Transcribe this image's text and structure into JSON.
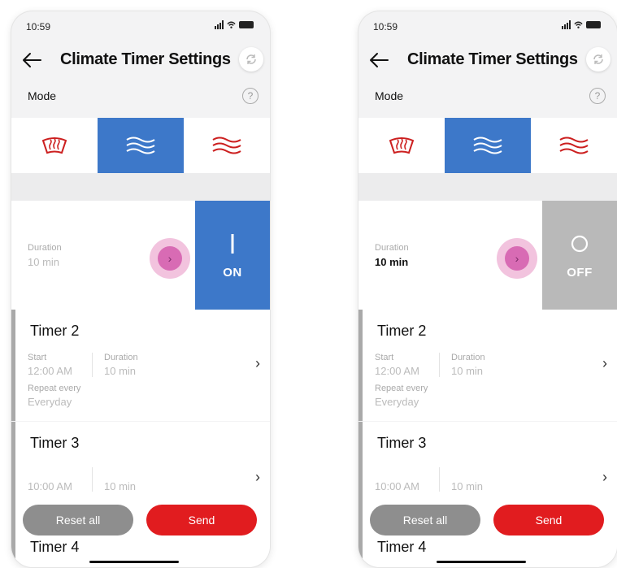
{
  "screens": [
    {
      "status_time": "10:59",
      "title": "Climate Timer Settings",
      "mode_label": "Mode",
      "help_glyph": "?",
      "modes": [
        {
          "icon": "defrost-icon",
          "active": false,
          "color": "#cc1f1f"
        },
        {
          "icon": "vent-airflow-icon",
          "active": true,
          "color": "#ffffff"
        },
        {
          "icon": "heat-airflow-icon",
          "active": false,
          "color": "#cc1f1f"
        }
      ],
      "timer1": {
        "duration_label": "Duration",
        "duration_value": "10 min",
        "toggle_label": "ON",
        "toggle_state": "on"
      },
      "timer2": {
        "name": "Timer 2",
        "start_label": "Start",
        "start_value": "12:00 AM",
        "duration_label": "Duration",
        "duration_value": "10 min",
        "repeat_label": "Repeat every",
        "repeat_value": "Everyday"
      },
      "timer3": {
        "name": "Timer 3",
        "start_value": "10:00 AM",
        "duration_value": "10 min"
      },
      "timer4": {
        "name": "Timer 4"
      },
      "reset_label": "Reset all",
      "send_label": "Send"
    },
    {
      "status_time": "10:59",
      "title": "Climate Timer Settings",
      "mode_label": "Mode",
      "help_glyph": "?",
      "modes": [
        {
          "icon": "defrost-icon",
          "active": false,
          "color": "#cc1f1f"
        },
        {
          "icon": "vent-airflow-icon",
          "active": true,
          "color": "#ffffff"
        },
        {
          "icon": "heat-airflow-icon",
          "active": false,
          "color": "#cc1f1f"
        }
      ],
      "timer1": {
        "duration_label": "Duration",
        "duration_value": "10 min",
        "toggle_label": "OFF",
        "toggle_state": "off"
      },
      "timer2": {
        "name": "Timer 2",
        "start_label": "Start",
        "start_value": "12:00 AM",
        "duration_label": "Duration",
        "duration_value": "10 min",
        "repeat_label": "Repeat every",
        "repeat_value": "Everyday"
      },
      "timer3": {
        "name": "Timer 3",
        "start_value": "10:00 AM",
        "duration_value": "10 min"
      },
      "timer4": {
        "name": "Timer 4"
      },
      "reset_label": "Reset all",
      "send_label": "Send"
    }
  ],
  "colors": {
    "accent_blue": "#3d78c9",
    "send_red": "#e11c1f",
    "reset_grey": "#8e8e8e",
    "toggle_off_grey": "#b9b9b9",
    "highlight_pink": "#d86bb4"
  }
}
